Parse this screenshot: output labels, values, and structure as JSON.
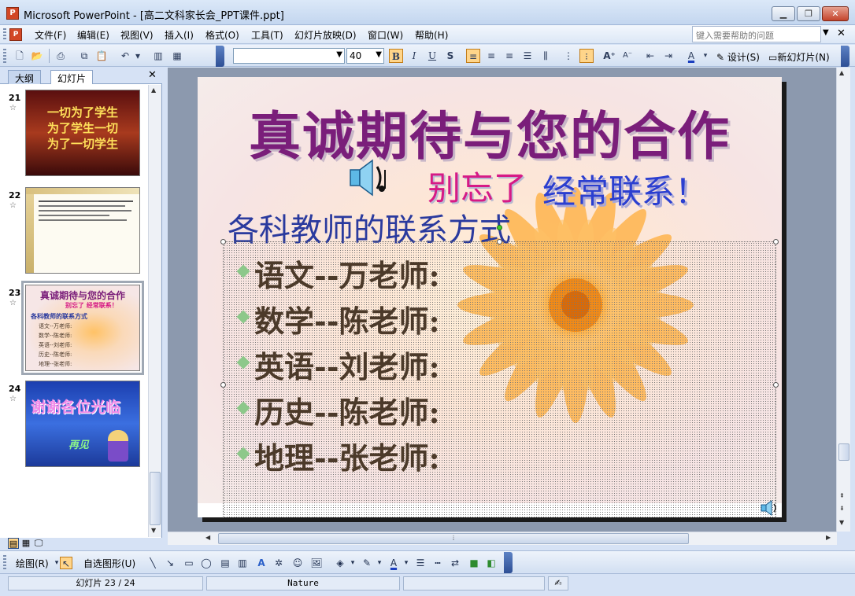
{
  "window": {
    "title": "Microsoft PowerPoint - [高二文科家长会_PPT课件.ppt]",
    "app_icon": "P"
  },
  "menu": {
    "items": [
      "文件(F)",
      "编辑(E)",
      "视图(V)",
      "插入(I)",
      "格式(O)",
      "工具(T)",
      "幻灯片放映(D)",
      "窗口(W)",
      "帮助(H)"
    ],
    "help_placeholder": "键入需要帮助的问题"
  },
  "toolbar": {
    "font_name": "",
    "font_size": "40",
    "bold": "B",
    "italic": "I",
    "underline": "U",
    "shadow": "S",
    "design_label": "设计(S)",
    "new_slide_label": "新幻灯片(N)"
  },
  "left_panel": {
    "tabs": [
      "大纲",
      "幻灯片"
    ],
    "active_tab": "幻灯片",
    "thumbnails": [
      {
        "number": "21",
        "text_lines": [
          "一切为了学生",
          "为了学生一切",
          "为了一切学生"
        ]
      },
      {
        "number": "22"
      },
      {
        "number": "23",
        "selected": true,
        "title": "真诚期待与您的合作",
        "subtitle": "别忘了 经常联系！",
        "section": "各科教师的联系方式",
        "lines": [
          "语文--万老师:",
          "数学--陈老师:",
          "英语--刘老师:",
          "历史--陈老师:",
          "地理--张老师:"
        ]
      },
      {
        "number": "24",
        "text": "谢谢各位光临",
        "sub": "再见"
      }
    ]
  },
  "slide": {
    "title": "真诚期待与您的合作",
    "subtitle_part1": "别忘了",
    "subtitle_part2": "经常联系！",
    "section_heading": "各科教师的联系方式",
    "bullets": [
      "语文--万老师:",
      "数学--陈老师:",
      "英语--刘老师:",
      "历史--陈老师:",
      "地理--张老师:"
    ]
  },
  "drawing_toolbar": {
    "draw_label": "绘图(R)",
    "autoshapes_label": "自选图形(U)"
  },
  "status": {
    "slide_counter": "幻灯片 23 / 24",
    "template": "Nature"
  },
  "colors": {
    "title": "#7a1e7a",
    "subtitle_pink": "#d61a86",
    "subtitle_blue": "#2b3fd0",
    "section": "#2a3a9e",
    "bullet_text": "#4c3a2a",
    "bullet_mark": "#8dc88a"
  }
}
